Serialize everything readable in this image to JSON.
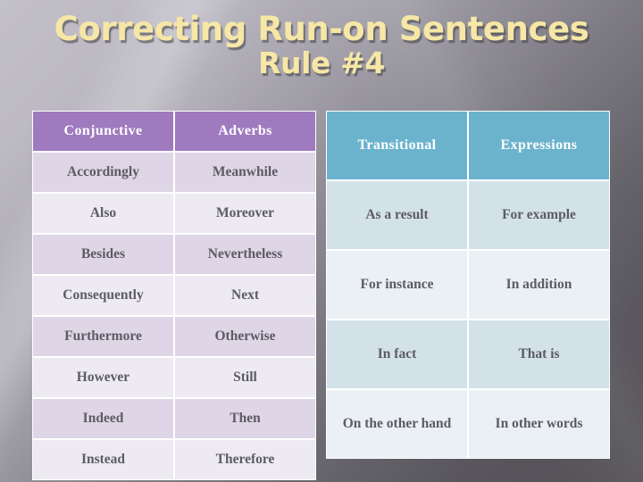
{
  "slide": {
    "title_line1": "Correcting Run-on Sentences",
    "title_line2": "Rule #4",
    "title_color": "#f6e7a6",
    "background_from": "#c3c0c9",
    "background_to": "#535156"
  },
  "left_table": {
    "name": "conjunctive-adverbs-table",
    "header_color": "#9f7abf",
    "row_shade_dark": "#ded6e6",
    "row_shade_light": "#edeaf2",
    "headers": [
      "Conjunctive",
      "Adverbs"
    ],
    "rows": [
      [
        "Accordingly",
        "Meanwhile"
      ],
      [
        "Also",
        "Moreover"
      ],
      [
        "Besides",
        "Nevertheless"
      ],
      [
        "Consequently",
        "Next"
      ],
      [
        "Furthermore",
        "Otherwise"
      ],
      [
        "However",
        "Still"
      ],
      [
        "Indeed",
        "Then"
      ],
      [
        "Instead",
        "Therefore"
      ]
    ]
  },
  "right_table": {
    "name": "transitional-expressions-table",
    "header_color": "#6bb3cd",
    "row_shade_dark": "#d3e2e9",
    "row_shade_light": "#eaf0f3",
    "headers": [
      "Transitional",
      "Expressions"
    ],
    "rows": [
      [
        "As a result",
        "For example"
      ],
      [
        "For instance",
        "In addition"
      ],
      [
        "In fact",
        "That is"
      ],
      [
        "On the other hand",
        "In other words"
      ]
    ]
  }
}
